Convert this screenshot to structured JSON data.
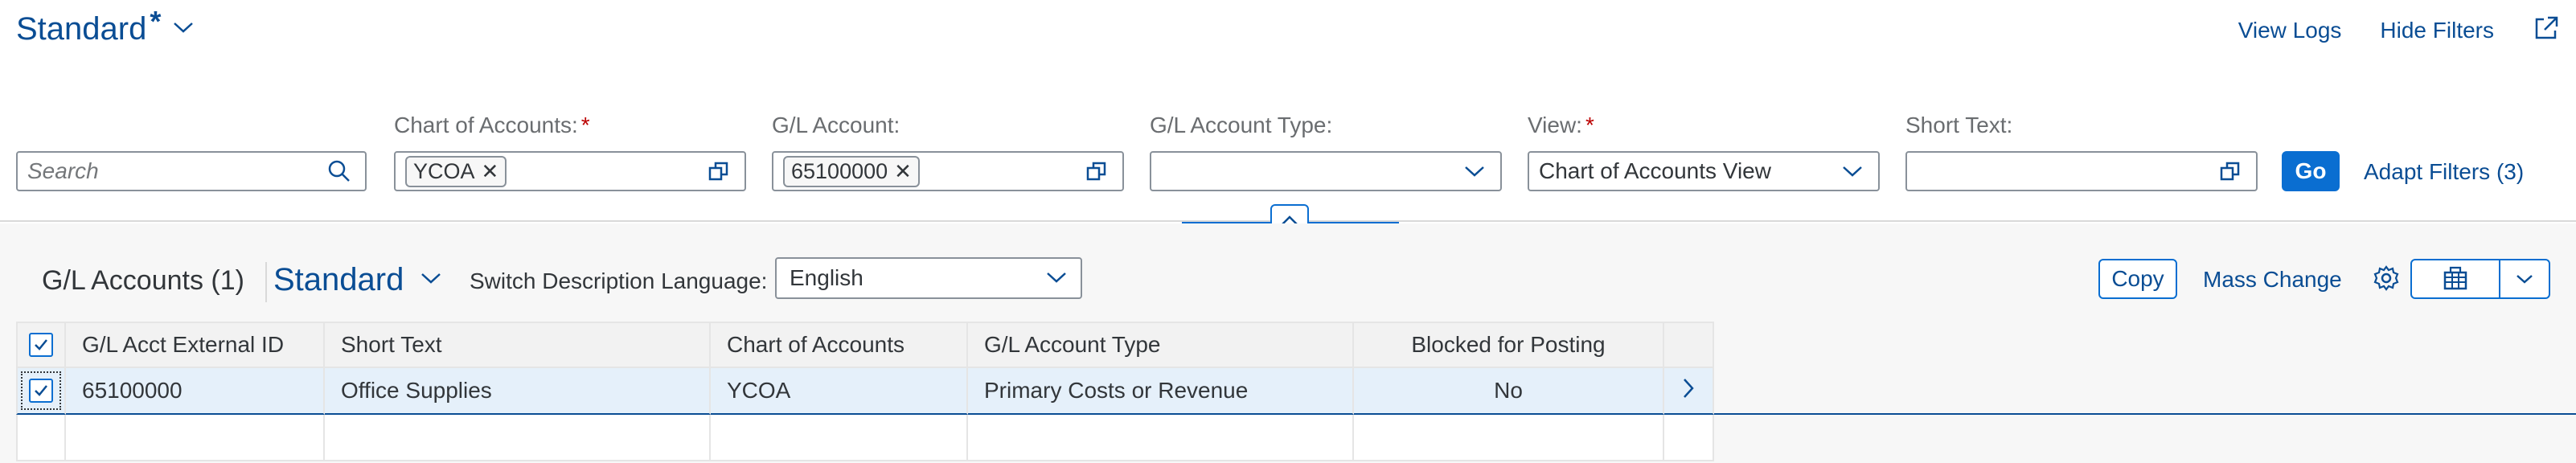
{
  "header": {
    "variant_name": "Standard",
    "variant_dirty_marker": "*",
    "actions": {
      "view_logs": "View Logs",
      "hide_filters": "Hide Filters"
    }
  },
  "filters": {
    "search": {
      "placeholder": "Search"
    },
    "chart_of_accounts": {
      "label": "Chart of Accounts:",
      "required": "*",
      "tokens": [
        "YCOA"
      ]
    },
    "gl_account": {
      "label": "G/L Account:",
      "tokens": [
        "65100000"
      ]
    },
    "gl_account_type": {
      "label": "G/L Account Type:",
      "value": ""
    },
    "view": {
      "label": "View:",
      "required": "*",
      "value": "Chart of Accounts View"
    },
    "short_text": {
      "label": "Short Text:",
      "value": ""
    },
    "go_label": "Go",
    "adapt_filters_label": "Adapt Filters (3)"
  },
  "table": {
    "title": "G/L Accounts (1)",
    "variant_name": "Standard",
    "switch_language_label": "Switch Description Language:",
    "language_value": "English",
    "copy_label": "Copy",
    "mass_change_label": "Mass Change",
    "columns": [
      "G/L Acct External ID",
      "Short Text",
      "Chart of Accounts",
      "G/L Account Type",
      "Blocked for Posting"
    ],
    "rows": [
      {
        "external_id": "65100000",
        "short_text": "Office Supplies",
        "chart_of_accounts": "YCOA",
        "account_type": "Primary Costs or Revenue",
        "blocked": "No"
      }
    ]
  },
  "colors": {
    "brand": "#0a6ed1",
    "link": "#0a4d94",
    "required": "#bb0000",
    "selected_row": "#e5f0fa"
  }
}
